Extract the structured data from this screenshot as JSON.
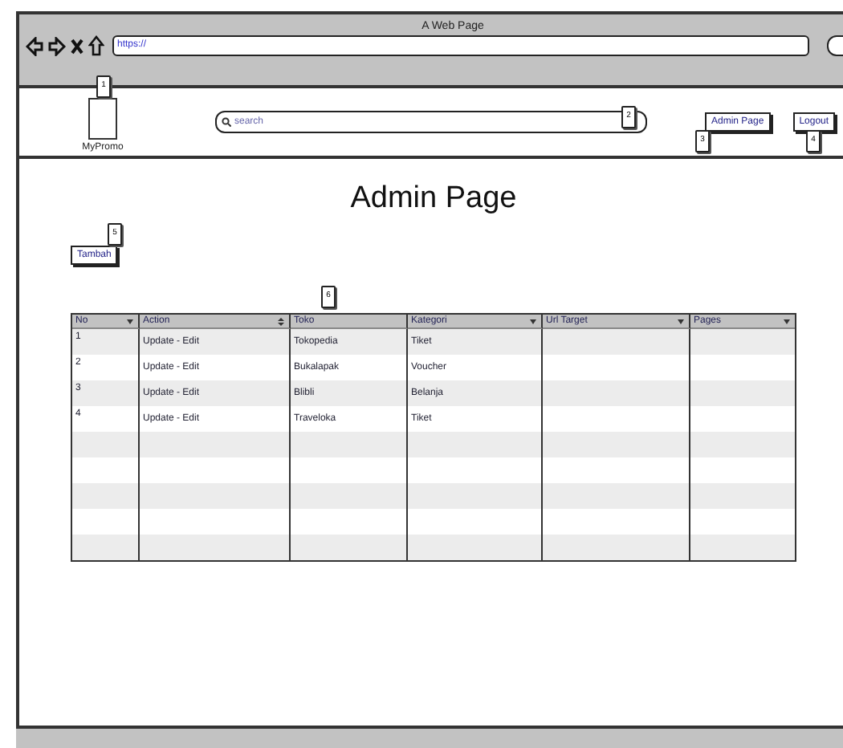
{
  "window": {
    "title": "A Web Page",
    "url": "https://"
  },
  "header": {
    "logo": "MyPromo",
    "search": {
      "placeholder": "search"
    },
    "buttons": [
      "Admin Page",
      "Logout"
    ]
  },
  "heading": "Admin Page",
  "add_button": "Tambah",
  "callouts": [
    "1",
    "2",
    "3",
    "4",
    "5",
    "6"
  ],
  "table": {
    "columns": [
      "No",
      "Action",
      "Toko",
      "Kategori",
      "Url Target",
      "Pages"
    ],
    "rows": [
      {
        "no": "1",
        "action": "Update - Edit",
        "toko": "Tokopedia",
        "kategori": "Tiket"
      },
      {
        "no": "2",
        "action": "Update - Edit",
        "toko": "Bukalapak",
        "kategori": "Voucher"
      },
      {
        "no": "3",
        "action": "Update - Edit",
        "toko": "Blibli",
        "kategori": "Belanja"
      },
      {
        "no": "4",
        "action": "Update - Edit",
        "toko": "Traveloka",
        "kategori": "Tiket"
      }
    ]
  }
}
